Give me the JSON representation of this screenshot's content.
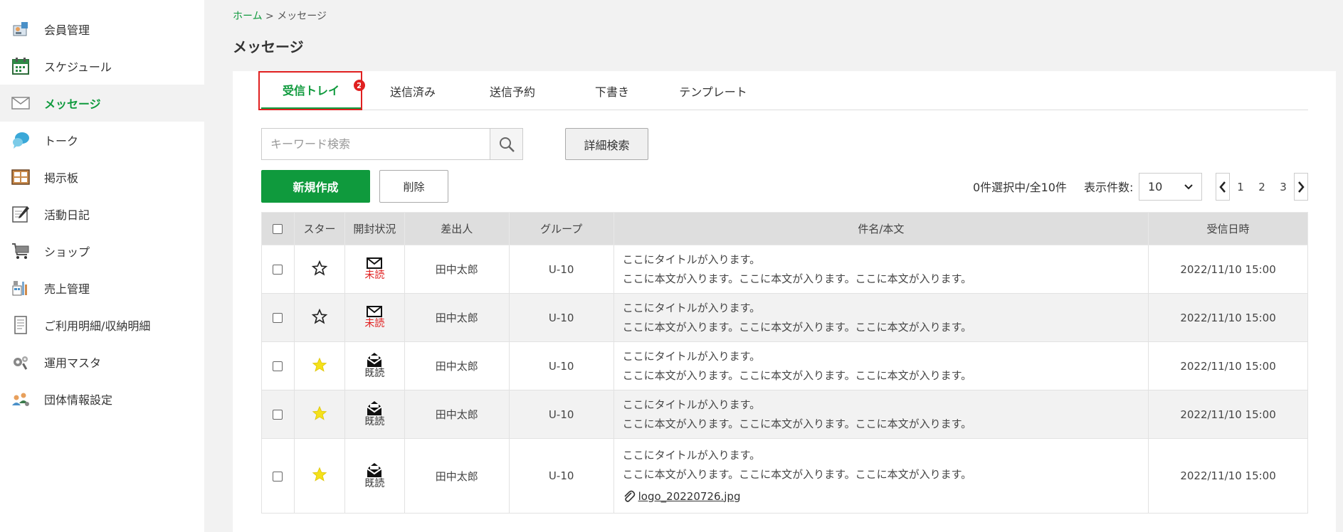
{
  "sidebar": {
    "items": [
      {
        "label": "会員管理",
        "icon": "members-icon"
      },
      {
        "label": "スケジュール",
        "icon": "calendar-icon"
      },
      {
        "label": "メッセージ",
        "icon": "envelope-icon",
        "active": true
      },
      {
        "label": "トーク",
        "icon": "chat-bubble-icon"
      },
      {
        "label": "掲示板",
        "icon": "bulletin-board-icon"
      },
      {
        "label": "活動日記",
        "icon": "diary-icon"
      },
      {
        "label": "ショップ",
        "icon": "shopping-cart-icon"
      },
      {
        "label": "売上管理",
        "icon": "sales-icon"
      },
      {
        "label": "ご利用明細/収納明細",
        "icon": "statement-icon"
      },
      {
        "label": "運用マスタ",
        "icon": "gears-icon"
      },
      {
        "label": "団体情報設定",
        "icon": "group-settings-icon"
      }
    ]
  },
  "breadcrumb": {
    "home": "ホーム",
    "separator": ">",
    "current": "メッセージ"
  },
  "page_title": "メッセージ",
  "tabs": [
    {
      "label": "受信トレイ",
      "active": true,
      "badge": "2"
    },
    {
      "label": "送信済み"
    },
    {
      "label": "送信予約"
    },
    {
      "label": "下書き"
    },
    {
      "label": "テンプレート"
    }
  ],
  "search": {
    "placeholder": "キーワード検索",
    "advanced_label": "詳細検索"
  },
  "actions": {
    "new_label": "新規作成",
    "delete_label": "削除"
  },
  "list_info": {
    "selection": "0件選択中/全10件",
    "per_page_label": "表示件数:",
    "per_page_value": "10",
    "pages": [
      "1",
      "2",
      "3"
    ]
  },
  "table": {
    "headers": {
      "star": "スター",
      "status": "開封状況",
      "sender": "差出人",
      "group": "グループ",
      "subject": "件名/本文",
      "date": "受信日時"
    },
    "rows": [
      {
        "starred": false,
        "status": "未読",
        "sender": "田中太郎",
        "group": "U-10",
        "title": "ここにタイトルが入ります。",
        "body": "ここに本文が入ります。ここに本文が入ります。ここに本文が入ります。",
        "date": "2022/11/10 15:00"
      },
      {
        "starred": false,
        "status": "未読",
        "sender": "田中太郎",
        "group": "U-10",
        "title": "ここにタイトルが入ります。",
        "body": "ここに本文が入ります。ここに本文が入ります。ここに本文が入ります。",
        "date": "2022/11/10 15:00"
      },
      {
        "starred": true,
        "status": "既読",
        "sender": "田中太郎",
        "group": "U-10",
        "title": "ここにタイトルが入ります。",
        "body": "ここに本文が入ります。ここに本文が入ります。ここに本文が入ります。",
        "date": "2022/11/10 15:00"
      },
      {
        "starred": true,
        "status": "既読",
        "sender": "田中太郎",
        "group": "U-10",
        "title": "ここにタイトルが入ります。",
        "body": "ここに本文が入ります。ここに本文が入ります。ここに本文が入ります。",
        "date": "2022/11/10 15:00"
      },
      {
        "starred": true,
        "status": "既読",
        "sender": "田中太郎",
        "group": "U-10",
        "title": "ここにタイトルが入ります。",
        "body": "ここに本文が入ります。ここに本文が入ります。ここに本文が入ります。",
        "date": "2022/11/10 15:00",
        "attachment": "logo_20220726.jpg"
      }
    ]
  },
  "colors": {
    "accent": "#0f9a3d",
    "unread": "#e02020",
    "star": "#f5e11a",
    "highlight": "#e02020"
  }
}
